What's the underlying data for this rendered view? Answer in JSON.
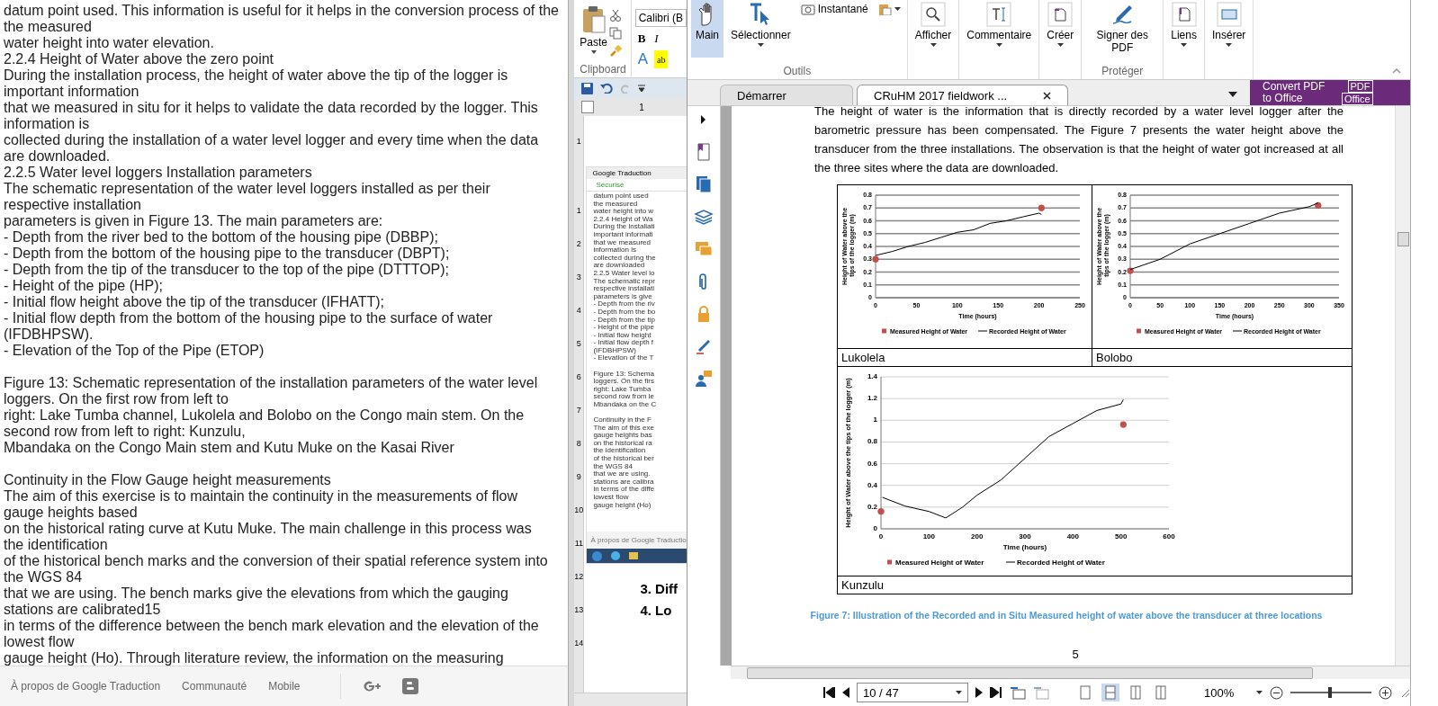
{
  "browser": {
    "paragraphs": [
      [
        "datum point used. This information is useful for it helps in the conversion process of the",
        "the measured",
        "water height into water elevation.",
        "2.2.4 Height of Water above the zero point",
        "During the installation process, the height of water above the tip of the logger is",
        "important information",
        "that we measured in situ for it helps to validate the data recorded by the logger. This",
        "information is",
        "collected during the installation of a water level logger and every time when the data",
        "are downloaded.",
        "2.2.5 Water level loggers Installation parameters",
        "The schematic representation of the water level loggers installed as per their",
        "respective installation",
        "parameters is given in Figure 13. The main parameters are:",
        "- Depth from the river bed to the bottom of the housing pipe (DBBP);",
        "- Depth from the bottom of the housing pipe to the transducer (DBPT);",
        "- Depth from the tip of the transducer to the top of the pipe (DTTTOP);",
        "- Height of the pipe (HP);",
        "- Initial flow height above the tip of the transducer (IFHATT);",
        "- Initial flow depth from the bottom of the housing pipe to the surface of water",
        "(IFDBHPSW).",
        "- Elevation of the Top of the Pipe (ETOP)"
      ],
      [
        "Figure 13: Schematic representation of the installation parameters of the water level",
        "loggers. On the first row from left to",
        "right: Lake Tumba channel, Lukolela and Bolobo on the Congo main stem. On the",
        "second row from left to right: Kunzulu,",
        "Mbandaka on the Congo Main stem and Kutu Muke on the Kasai River"
      ],
      [
        " Continuity in the Flow Gauge height measurements",
        "The aim of this exercise is to maintain the continuity in the measurements of flow",
        "gauge heights based",
        "on the historical rating curve at Kutu Muke. The main challenge in this process was",
        "the identification",
        "of the historical bench marks and the conversion of their spatial reference system into",
        "the WGS 84",
        "that we are using. The bench marks give the elevations from which the gauging",
        "stations are calibrated15",
        "in terms of the difference between the bench mark elevation and the elevation of the",
        "lowest flow",
        "gauge height (Ho). Through literature review, the information on the measuring"
      ]
    ],
    "footer_links": [
      "À propos de Google Traduction",
      "Communauté",
      "Mobile"
    ]
  },
  "word": {
    "paste": "Paste",
    "group": "Clipboard",
    "font": "Calibri (B",
    "bold": "B",
    "italic": "I",
    "highlight": "ab",
    "font_color": "A",
    "ruler": "1",
    "vertical_ruler": [
      "1",
      "1",
      "2",
      "3",
      "4",
      "5",
      "6",
      "7",
      "8",
      "9",
      "10",
      "11",
      "12",
      "13",
      "14"
    ],
    "thumbnail": {
      "tab": "Google Traduction",
      "address": "Sécurisé",
      "paragraphs": [
        [
          "datum point used",
          "the measured",
          "water height into w",
          "2.2.4 Height of Wa",
          "During the installati",
          "important informati",
          "that we measured",
          "information is",
          "collected during the",
          "are downloaded",
          "2.2.5 Water level lo",
          "The schematic repr",
          "respective installati",
          "parameters is give",
          "- Depth from the riv",
          "- Depth from the bo",
          "- Depth from the tip",
          "- Height of the pipe",
          "- Initial flow height",
          "- Initial flow depth f",
          "(IFDBHPSW)",
          "- Elevation of the T"
        ],
        [
          "Figure 13: Schema",
          "loggers. On the firs",
          "right: Lake Tumba",
          "second row from le",
          "Mbandaka on the C"
        ],
        [
          " Continuity in the F",
          "The aim of this exe",
          "gauge heights bas",
          "on the historical ra",
          "the identification",
          "of the historical ber",
          "the WGS 84",
          "that we are using.",
          "stations are calibra",
          "in terms of the diffe",
          "lowest flow",
          "gauge height (Ho)"
        ]
      ],
      "footer": "À propos de Google Traductio"
    },
    "headings": [
      "3.  Diff",
      "4.  Lo"
    ]
  },
  "pdf": {
    "ribbon": [
      {
        "label": "Outils",
        "tools": [
          {
            "kind": "large",
            "label": "Main",
            "selected": true,
            "dropdown": false
          },
          {
            "kind": "large",
            "label": "Sélectionner",
            "selected": false,
            "dropdown": true
          },
          {
            "kind": "small",
            "label": "Instantané",
            "selected": false,
            "dropdown": false
          },
          {
            "kind": "small",
            "selected": false,
            "dropdown": true
          }
        ]
      },
      {
        "tools": [
          {
            "kind": "large",
            "label": "Afficher",
            "selected": false,
            "dropdown": true
          }
        ]
      },
      {
        "tools": [
          {
            "kind": "large",
            "label": "Commentaire",
            "selected": false,
            "dropdown": true
          }
        ]
      },
      {
        "tools": [
          {
            "kind": "large",
            "label": "Créer",
            "selected": false,
            "dropdown": true
          }
        ]
      },
      {
        "label": "Protéger",
        "tools": [
          {
            "kind": "large",
            "label": "Signer des PDF",
            "selected": false,
            "dropdown": false
          }
        ]
      },
      {
        "tools": [
          {
            "kind": "large",
            "label": "Liens",
            "selected": false,
            "dropdown": true
          }
        ]
      },
      {
        "tools": [
          {
            "kind": "large",
            "label": "Insérer",
            "selected": false,
            "dropdown": true
          }
        ]
      }
    ],
    "tabs": [
      {
        "label": "Démarrer",
        "selected": false,
        "closable": false
      },
      {
        "label": "CRuHM 2017 fieldwork ...",
        "selected": true,
        "closable": true
      }
    ],
    "convert": {
      "text": "Convert PDF to Office",
      "badge_top": "PDF",
      "badge_bottom": "Office"
    },
    "page": {
      "paragraph": "The height of water is the information that is directly recorded by a water level logger after the barometric pressure has been compensated.   The Figure 7 presents the water height above the transducer from the three installations. The observation is that the height of water got increased at all the three sites where the data are downloaded.",
      "cells": [
        {
          "label": "Lukolela",
          "chart_data": {
            "type": "line",
            "grid": true,
            "legend": "bottom",
            "xlabel": "Time (hours)",
            "ylabel": "Height of Water above the tips of the logger (m)",
            "x": [
              0,
              20,
              40,
              60,
              80,
              100,
              120,
              140,
              160,
              180,
              200,
              203
            ],
            "series": [
              {
                "name": "Measured Height of Water",
                "type": "scatter",
                "color": "#c0504d",
                "values": [
                  0.3,
                  null,
                  null,
                  null,
                  null,
                  null,
                  null,
                  null,
                  null,
                  null,
                  null,
                  0.7
                ]
              },
              {
                "name": "Recorded Height of Water",
                "type": "line",
                "color": "#000000",
                "values": [
                  0.33,
                  0.36,
                  0.4,
                  0.43,
                  0.47,
                  0.51,
                  0.53,
                  0.58,
                  0.6,
                  0.63,
                  0.66,
                  0.65
                ]
              }
            ],
            "xlim": [
              0,
              250
            ],
            "ylim": [
              0,
              0.8
            ],
            "xticks": [
              0,
              50,
              100,
              150,
              200,
              250
            ],
            "yticks": [
              0,
              0.1,
              0.2,
              0.3,
              0.4,
              0.5,
              0.6,
              0.7,
              0.8
            ]
          }
        },
        {
          "label": "Bolobo",
          "chart_data": {
            "type": "line",
            "grid": true,
            "legend": "bottom",
            "xlabel": "Time (hours)",
            "ylabel": "Height of Water above the tips of the logger (m)",
            "x": [
              0,
              50,
              100,
              150,
              200,
              250,
              300,
              315
            ],
            "series": [
              {
                "name": "Measured Height of Water",
                "type": "scatter",
                "color": "#c0504d",
                "values": [
                  0.21,
                  null,
                  null,
                  null,
                  null,
                  null,
                  null,
                  0.72
                ]
              },
              {
                "name": "Recorded Height of Water",
                "type": "line",
                "color": "#000000",
                "values": [
                  0.22,
                  0.3,
                  0.42,
                  0.5,
                  0.58,
                  0.66,
                  0.71,
                  0.74
                ]
              }
            ],
            "xlim": [
              0,
              350
            ],
            "ylim": [
              0,
              0.8
            ],
            "xticks": [
              0,
              50,
              100,
              150,
              200,
              250,
              300,
              350
            ],
            "yticks": [
              0,
              0.1,
              0.2,
              0.3,
              0.4,
              0.5,
              0.6,
              0.7,
              0.8
            ]
          }
        },
        {
          "label": "Kunzulu",
          "chart_data": {
            "type": "line",
            "grid": true,
            "legend": "bottom",
            "xlabel": "Time (hours)",
            "ylabel": "Height of Water above the tips of the logger  (m)",
            "x": [
              0,
              3,
              50,
              100,
              135,
              170,
              200,
              250,
              300,
              350,
              400,
              450,
              500,
              505
            ],
            "series": [
              {
                "name": "Measured Height of Water",
                "type": "scatter",
                "color": "#c0504d",
                "values": [
                  0.16,
                  null,
                  null,
                  null,
                  null,
                  null,
                  null,
                  null,
                  null,
                  null,
                  null,
                  null,
                  null,
                  0.96
                ]
              },
              {
                "name": "Recorded Height of Water",
                "type": "line",
                "color": "#000000",
                "values": [
                  null,
                  0.29,
                  0.21,
                  0.16,
                  0.1,
                  0.2,
                  0.31,
                  0.45,
                  0.65,
                  0.85,
                  0.97,
                  1.09,
                  1.15,
                  1.19
                ]
              }
            ],
            "xlim": [
              0,
              600
            ],
            "ylim": [
              0,
              1.4
            ],
            "xticks": [
              0,
              100,
              200,
              300,
              400,
              500,
              600
            ],
            "yticks": [
              0,
              0.2,
              0.4,
              0.6,
              0.8,
              1,
              1.2,
              1.4
            ]
          }
        }
      ],
      "caption": "Figure 7: Illustration of the Recorded and in Situ Measured height of water above the transducer at three locations",
      "page_number": "5"
    },
    "navigation": {
      "page": "10 / 47",
      "views": [
        {
          "selected": false
        },
        {
          "selected": true
        },
        {
          "selected": false
        },
        {
          "selected": false
        }
      ],
      "zoom": "100%",
      "zoom_level": {
        "level": 0.49
      }
    }
  }
}
